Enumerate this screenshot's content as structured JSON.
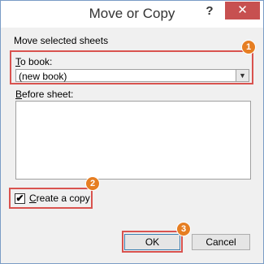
{
  "window": {
    "title": "Move or Copy",
    "help_label": "?",
    "close_label": "✕"
  },
  "move": {
    "section_label": "Move selected sheets",
    "to_book_label_hotkey": "T",
    "to_book_label_rest": "o book:",
    "to_book_value": "(new book)",
    "before_sheet_label_hotkey": "B",
    "before_sheet_label_rest": "efore sheet:",
    "before_sheet_items": []
  },
  "copy": {
    "checked": true,
    "check_mark": "✔",
    "label_hotkey": "C",
    "label_rest": "reate a copy"
  },
  "buttons": {
    "ok": "OK",
    "cancel": "Cancel"
  },
  "annotations": {
    "badge_1": "1",
    "badge_2": "2",
    "badge_3": "3",
    "highlight_color": "#d9534f",
    "badge_color": "#e67e22"
  },
  "icons": {
    "dropdown": "chevron-down-icon",
    "close": "close-icon",
    "help": "help-icon"
  }
}
